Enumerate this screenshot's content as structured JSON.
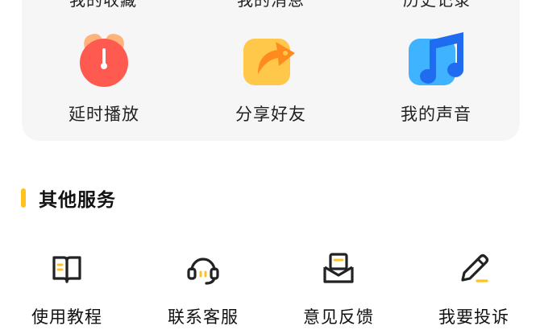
{
  "features": [
    {
      "label": "延时播放",
      "icon": "alarm-clock-icon"
    },
    {
      "label": "分享好友",
      "icon": "share-arrow-icon"
    },
    {
      "label": "我的声音",
      "icon": "music-note-icon"
    }
  ],
  "cut_labels": [
    "我的收藏",
    "我的消息",
    "历史记录"
  ],
  "other_services": {
    "title": "其他服务",
    "items": [
      {
        "label": "使用教程",
        "icon": "book-icon"
      },
      {
        "label": "联系客服",
        "icon": "headset-icon"
      },
      {
        "label": "意见反馈",
        "icon": "feedback-mail-icon"
      },
      {
        "label": "我要投诉",
        "icon": "pencil-icon"
      }
    ]
  },
  "colors": {
    "accent": "#ffc21f",
    "alarm_red": "#ff5a4f",
    "share_orange": "#ff8a1e",
    "music_blue": "#1f8cff"
  }
}
